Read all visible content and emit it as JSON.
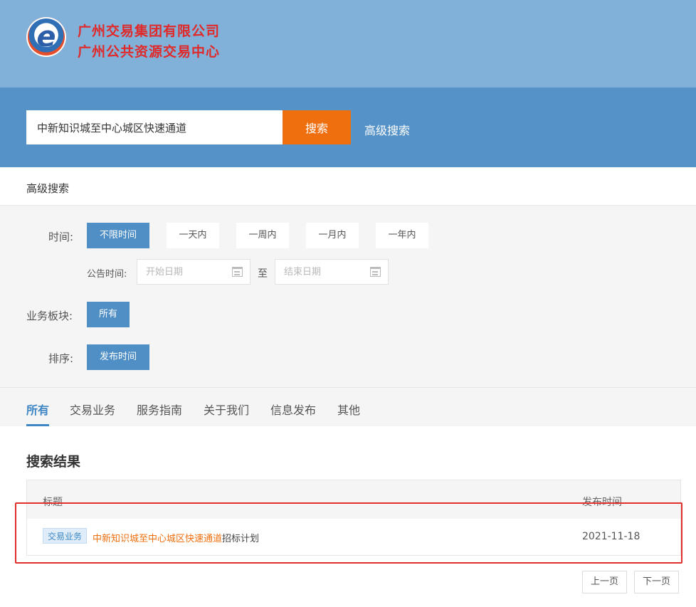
{
  "header": {
    "org_line1": "广州交易集团有限公司",
    "org_line2": "广州公共资源交易中心",
    "logo_letter": "e"
  },
  "search": {
    "value": "中新知识城至中心城区快速通道",
    "button_label": "搜索",
    "advanced_link": "高级搜索"
  },
  "advanced": {
    "title": "高级搜索",
    "time_label": "时间:",
    "time_options": [
      "不限时间",
      "一天内",
      "一周内",
      "一月内",
      "一年内"
    ],
    "time_selected": "不限时间",
    "date_label": "公告时间:",
    "start_placeholder": "开始日期",
    "end_placeholder": "结束日期",
    "date_separator": "至",
    "sector_label": "业务板块:",
    "sector_selected": "所有",
    "sort_label": "排序:",
    "sort_selected": "发布时间"
  },
  "tabs": [
    {
      "label": "所有",
      "active": true
    },
    {
      "label": "交易业务",
      "active": false
    },
    {
      "label": "服务指南",
      "active": false
    },
    {
      "label": "关于我们",
      "active": false
    },
    {
      "label": "信息发布",
      "active": false
    },
    {
      "label": "其他",
      "active": false
    }
  ],
  "results": {
    "title": "搜索结果",
    "columns": [
      "标题",
      "发布时间"
    ],
    "rows": [
      {
        "tag": "交易业务",
        "title_highlight": "中新知识城至中心城区快速通道",
        "title_rest": "招标计划",
        "date": "2021-11-18"
      }
    ]
  },
  "pager": {
    "prev_label": "上一页",
    "next_label": "下一页"
  },
  "colors": {
    "header_bg": "#81b0d9",
    "search_band_bg": "#5492c7",
    "accent_orange": "#ef6f0f",
    "accent_blue": "#4f8fc6",
    "org_name_red": "#e02a2a",
    "highlight_box_red": "#e0302e"
  }
}
